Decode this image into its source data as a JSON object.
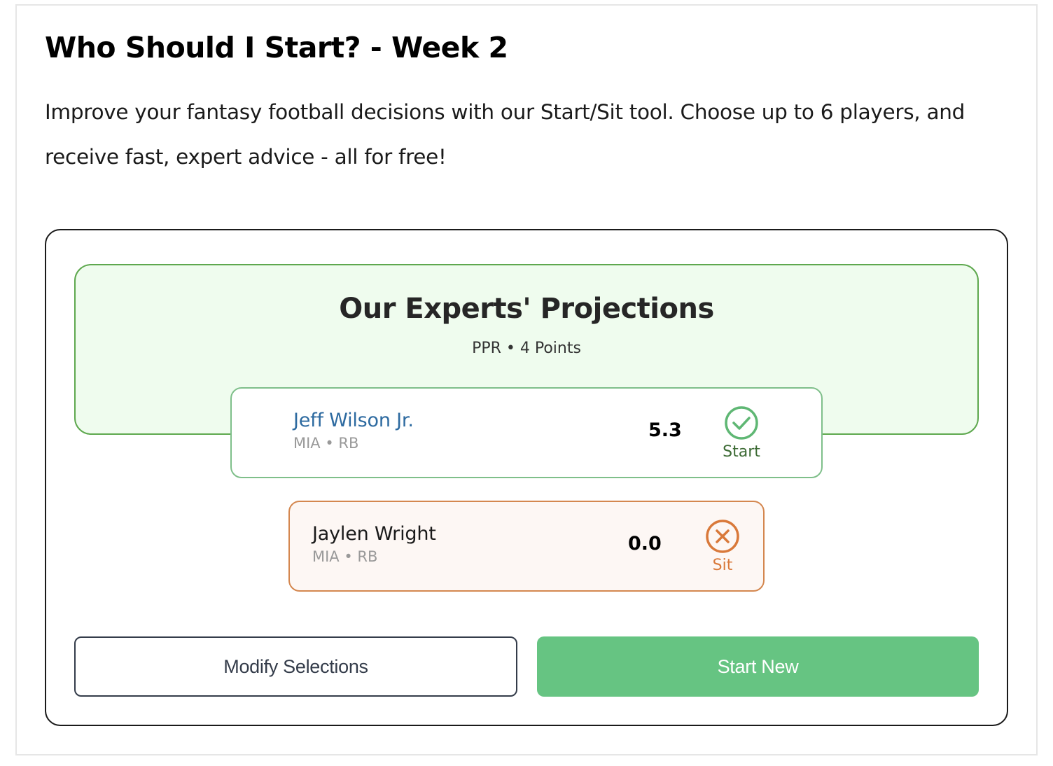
{
  "header": {
    "title": "Who Should I Start? - Week 2",
    "intro": "Improve your fantasy football decisions with our Start/Sit tool. Choose up to 6 players, and receive fast, expert advice - all for free!"
  },
  "projections": {
    "title": "Our Experts' Projections",
    "subtitle": "PPR • 4 Points",
    "players": [
      {
        "name": "Jeff Wilson Jr.",
        "meta": "MIA • RB",
        "score": "5.3",
        "verdict": "Start",
        "verdict_icon": "check-circle-icon",
        "color": "#5fb774"
      },
      {
        "name": "Jaylen Wright",
        "meta": "MIA • RB",
        "score": "0.0",
        "verdict": "Sit",
        "verdict_icon": "x-circle-icon",
        "color": "#d9793a"
      }
    ]
  },
  "actions": {
    "modify_label": "Modify Selections",
    "new_label": "Start New"
  },
  "colors": {
    "start_green": "#5fb774",
    "sit_orange": "#d9793a",
    "panel_bg": "#effcee",
    "button_green": "#66c482"
  }
}
